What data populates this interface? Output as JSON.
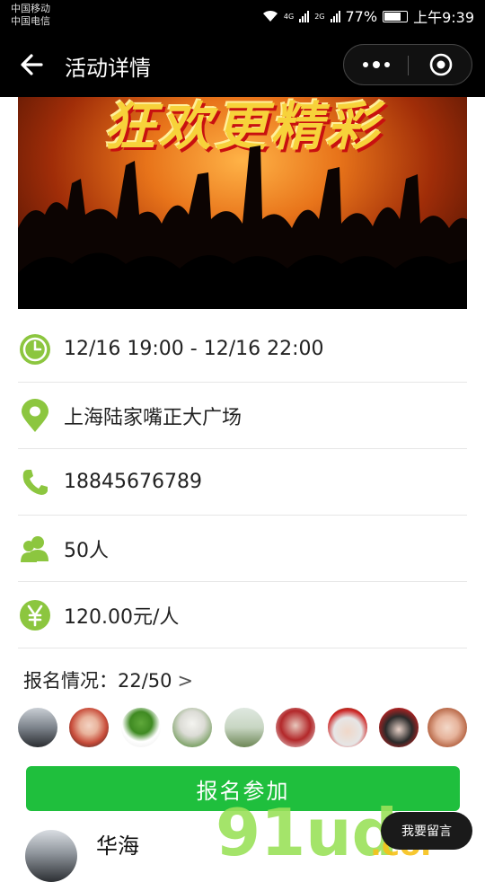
{
  "status_bar": {
    "carrier_1": "中国移动",
    "carrier_2": "中国电信",
    "net_1": "4G",
    "net_2": "2G",
    "battery": "77%",
    "time": "上午9:39"
  },
  "nav": {
    "title": "活动详情",
    "back_icon": "arrow-left-icon",
    "more_icon": "more-dots-icon",
    "close_icon": "target-close-icon"
  },
  "banner": {
    "text": "狂欢更精彩"
  },
  "info": {
    "time": "12/16 19:00 - 12/16 22:00",
    "location": "上海陆家嘴正大广场",
    "phone": "18845676789",
    "capacity": "50人",
    "price": "120.00元/人"
  },
  "signup": {
    "label": "报名情况：",
    "count": "22/50",
    "chevron": ">"
  },
  "avatars": [
    "car",
    "girl-red-hair",
    "frog-supreme",
    "polar-bear",
    "landscape",
    "santa-red",
    "santa-kid",
    "santa-woman",
    "girl-glasses"
  ],
  "join_button": "报名参加",
  "comment": {
    "name": "华海"
  },
  "leave_message_button": "我要留言",
  "watermark": {
    "text_main": "91ud",
    "text_suffix": ".com"
  },
  "colors": {
    "accent_green": "#1fbf3d",
    "icon_green": "#8cc63f"
  }
}
